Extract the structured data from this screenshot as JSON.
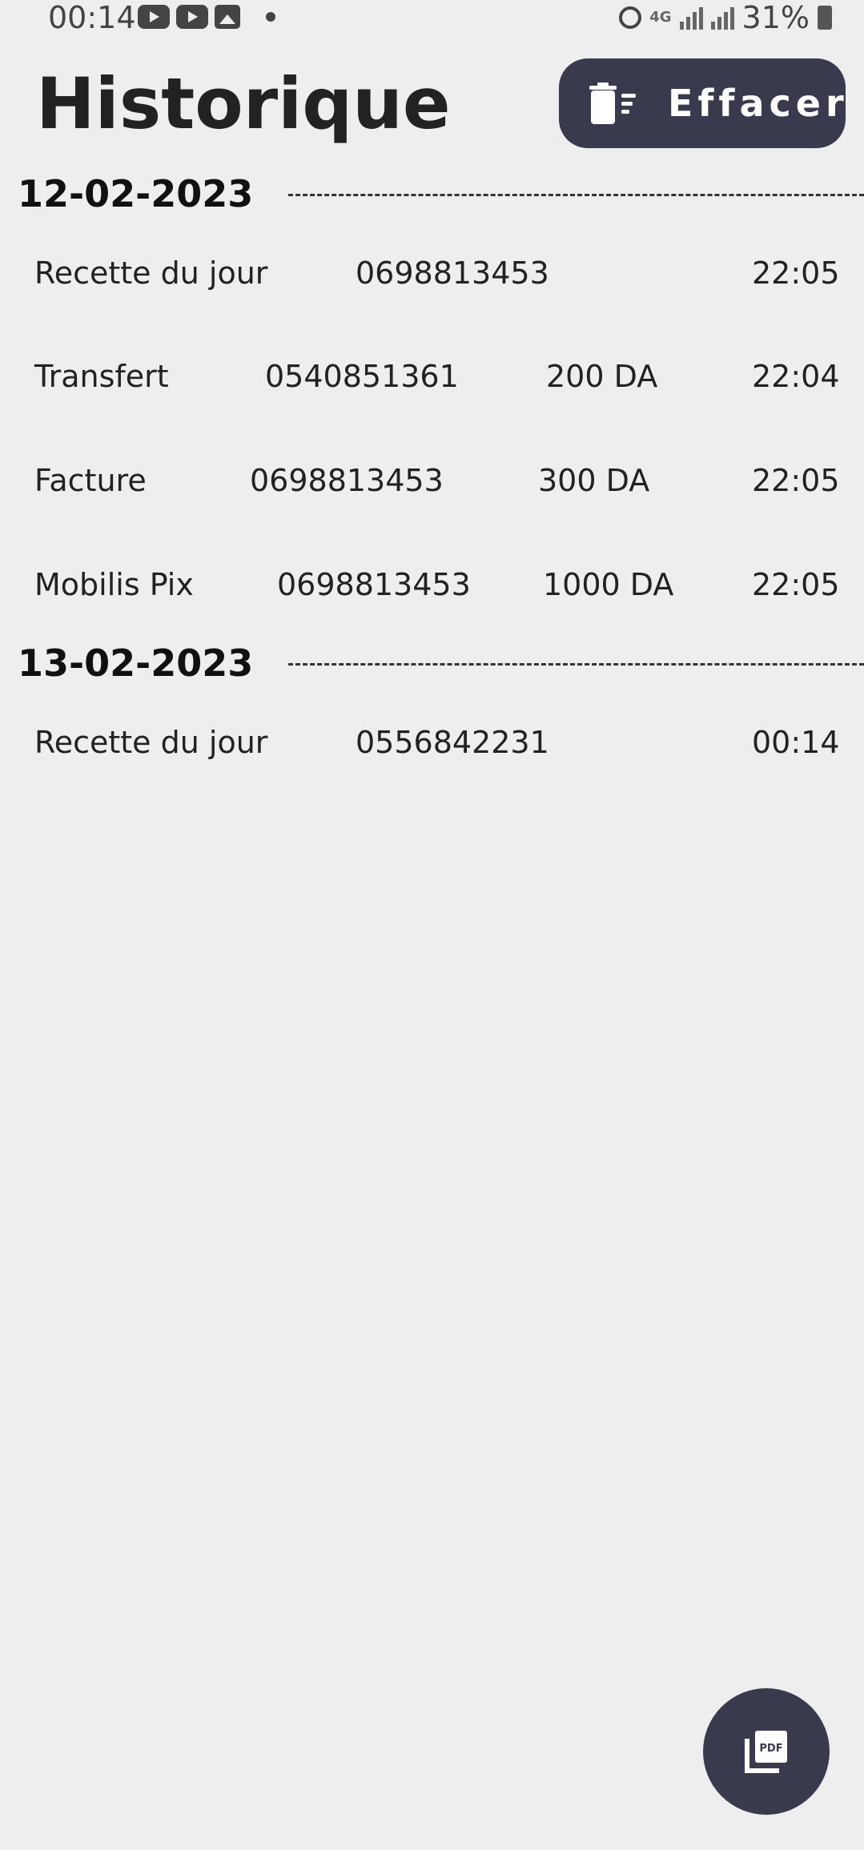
{
  "status_bar": {
    "time": "00:14",
    "network": "4G",
    "battery": "31%",
    "icons": [
      "youtube-icon",
      "youtube-icon",
      "gallery-icon",
      "dot-icon",
      "alarm-icon",
      "signal-icon",
      "battery-icon"
    ]
  },
  "header": {
    "title": "Historique",
    "clear_label": "Effacer"
  },
  "groups": [
    {
      "date": "12-02-2023",
      "entries": [
        {
          "type": "Recette du jour",
          "number": "0698813453",
          "amount": "",
          "time": "22:05"
        },
        {
          "type": "Transfert",
          "number": "0540851361",
          "amount": "200 DA",
          "time": "22:04"
        },
        {
          "type": "Facture",
          "number": "0698813453",
          "amount": "300 DA",
          "time": "22:05"
        },
        {
          "type": "Mobilis Pix",
          "number": "0698813453",
          "amount": "1000 DA",
          "time": "22:05"
        }
      ]
    },
    {
      "date": "13-02-2023",
      "entries": [
        {
          "type": "Recette du jour",
          "number": "0556842231",
          "amount": "",
          "time": "00:14"
        }
      ]
    }
  ],
  "fab": {
    "icon": "pdf-icon"
  },
  "colors": {
    "background": "#eeeeee",
    "button": "#3a3a4e",
    "text": "#222222"
  }
}
